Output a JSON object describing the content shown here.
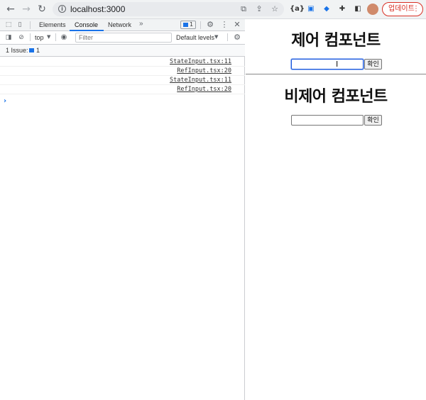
{
  "browser": {
    "url": "localhost:3000",
    "update_label": "업데이트",
    "ext_1_label": "{a}",
    "nav_back_glyph": "←",
    "nav_forward_glyph": "→",
    "nav_reload_glyph": "↻"
  },
  "devtools": {
    "tabs": [
      "Elements",
      "Console",
      "Network"
    ],
    "active_tab": "Console",
    "more_tabs_glyph": "»",
    "issue_badge_count": "1",
    "context": "top",
    "filter_placeholder": "Filter",
    "levels": "Default levels",
    "issue_label": "1 Issue:",
    "issue_count": "1",
    "logs": [
      {
        "source": "StateInput.tsx:11"
      },
      {
        "source": "RefInput.tsx:20"
      },
      {
        "source": "StateInput.tsx:11"
      },
      {
        "source": "RefInput.tsx:20"
      }
    ]
  },
  "page": {
    "controlled": {
      "title": "제어 컴포넌트",
      "input_value": "",
      "button_label": "확인"
    },
    "uncontrolled": {
      "title": "비제어 컴포넌트",
      "input_value": "",
      "button_label": "확인"
    }
  },
  "colors": {
    "accent": "#1a73e8",
    "update_red": "#d93025"
  }
}
